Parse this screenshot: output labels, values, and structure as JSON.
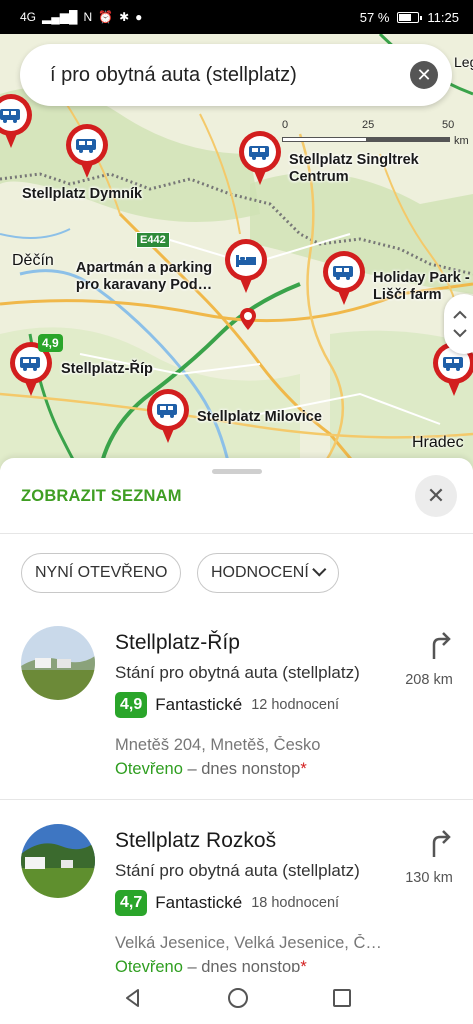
{
  "status_bar": {
    "network": "4G",
    "battery": "57 %",
    "time": "11:25"
  },
  "search": {
    "query": "í pro obytná auta (stellplatz)"
  },
  "map": {
    "scale_labels": [
      "0",
      "25",
      "50",
      "km"
    ],
    "road_label": "E442",
    "towns": [
      "Děčín",
      "Hradec",
      "Leg"
    ],
    "pins": [
      {
        "label": "Stellplatz Dymník",
        "icon": "camper-van-icon"
      },
      {
        "label": "Stellplatz Singltrek Centrum",
        "icon": "camper-van-icon"
      },
      {
        "label": "Apartmán a parking pro karavany Pod…",
        "icon": "bed-icon"
      },
      {
        "label": "Holiday Park - Liščí farm",
        "icon": "camper-van-icon"
      },
      {
        "label": "Stellplatz-Říp",
        "icon": "camper-van-icon",
        "rating": "4,9"
      },
      {
        "label": "Stellplatz Milovice",
        "icon": "camper-van-icon"
      }
    ],
    "partial_rating": "4"
  },
  "sheet": {
    "show_list": "ZOBRAZIT SEZNAM",
    "filters": [
      "NYNÍ OTEVŘENO",
      "HODNOCENÍ"
    ]
  },
  "results": [
    {
      "title": "Stellplatz-Říp",
      "category": "Stání pro obytná auta (stellplatz)",
      "rating": "4,9",
      "rating_word": "Fantastické",
      "rating_count": "12 hodnocení",
      "address": "Mnetěš 204, Mnetěš, Česko",
      "open_word": "Otevřeno",
      "open_rest": " – dnes nonstop",
      "open_star": "*",
      "distance": "208 km"
    },
    {
      "title": "Stellplatz Rozkoš",
      "category": "Stání pro obytná auta (stellplatz)",
      "rating": "4,7",
      "rating_word": "Fantastické",
      "rating_count": "18 hodnocení",
      "address": "Velká Jesenice, Velká Jesenice, Č…",
      "open_word": "Otevřeno",
      "open_rest": " – dnes nonstop",
      "open_star": "*",
      "distance": "130 km"
    }
  ],
  "colors": {
    "accent_green": "#3f9e23",
    "pin_red": "#d21e1e",
    "rating_green": "#2aa52a"
  }
}
